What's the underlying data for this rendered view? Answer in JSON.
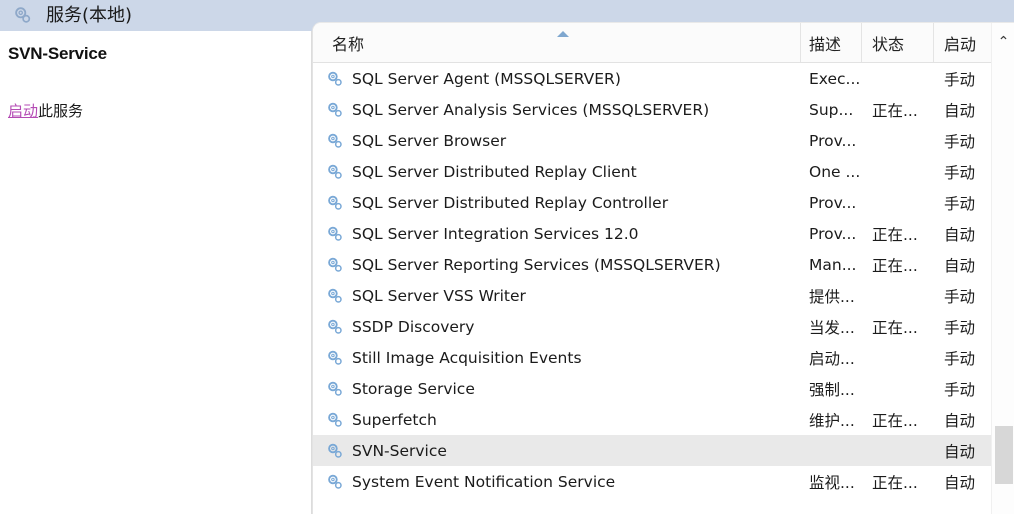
{
  "window": {
    "header_title": "服务(本地)",
    "header_icon": "service-gear-icon"
  },
  "details_pane": {
    "service_name": "SVN-Service",
    "action_link_label": "启动",
    "action_suffix_label": "此服务"
  },
  "list": {
    "columns": [
      {
        "key": "name",
        "label": "名称"
      },
      {
        "key": "desc",
        "label": "描述"
      },
      {
        "key": "state",
        "label": "状态"
      },
      {
        "key": "start",
        "label": "启动"
      }
    ],
    "sort": {
      "column": "名称",
      "direction": "ascending",
      "indicator": "sort-ascending-arrow-icon"
    },
    "scrollbar": {
      "up_arrow": "⌃",
      "thumb_visible": true
    },
    "row_icon": "service-gear-icon",
    "rows": [
      {
        "name": "SQL Server Agent (MSSQLSERVER)",
        "desc": "Exec...",
        "state": "",
        "start": "手动",
        "selected": false
      },
      {
        "name": "SQL Server Analysis Services (MSSQLSERVER)",
        "desc": "Sup...",
        "state": "正在...",
        "start": "自动",
        "selected": false
      },
      {
        "name": "SQL Server Browser",
        "desc": "Prov...",
        "state": "",
        "start": "手动",
        "selected": false
      },
      {
        "name": "SQL Server Distributed Replay Client",
        "desc": "One ...",
        "state": "",
        "start": "手动",
        "selected": false
      },
      {
        "name": "SQL Server Distributed Replay Controller",
        "desc": "Prov...",
        "state": "",
        "start": "手动",
        "selected": false
      },
      {
        "name": "SQL Server Integration Services 12.0",
        "desc": "Prov...",
        "state": "正在...",
        "start": "自动",
        "selected": false
      },
      {
        "name": "SQL Server Reporting Services (MSSQLSERVER)",
        "desc": "Man...",
        "state": "正在...",
        "start": "自动",
        "selected": false
      },
      {
        "name": "SQL Server VSS Writer",
        "desc": "提供...",
        "state": "",
        "start": "手动",
        "selected": false
      },
      {
        "name": "SSDP Discovery",
        "desc": "当发...",
        "state": "正在...",
        "start": "手动",
        "selected": false
      },
      {
        "name": "Still Image Acquisition Events",
        "desc": "启动...",
        "state": "",
        "start": "手动",
        "selected": false
      },
      {
        "name": "Storage Service",
        "desc": "强制...",
        "state": "",
        "start": "手动",
        "selected": false
      },
      {
        "name": "Superfetch",
        "desc": "维护...",
        "state": "正在...",
        "start": "自动",
        "selected": false
      },
      {
        "name": "SVN-Service",
        "desc": "",
        "state": "",
        "start": "自动",
        "selected": true
      },
      {
        "name": "System Event Notification Service",
        "desc": "监视...",
        "state": "正在...",
        "start": "自动",
        "selected": false
      }
    ]
  },
  "colors": {
    "header_band": "#ccd7e8",
    "link": "#b44bb4",
    "selection": "#e9e9e9",
    "gear_icon": "#79a8d6",
    "sort_arrow": "#7fa7cf"
  }
}
